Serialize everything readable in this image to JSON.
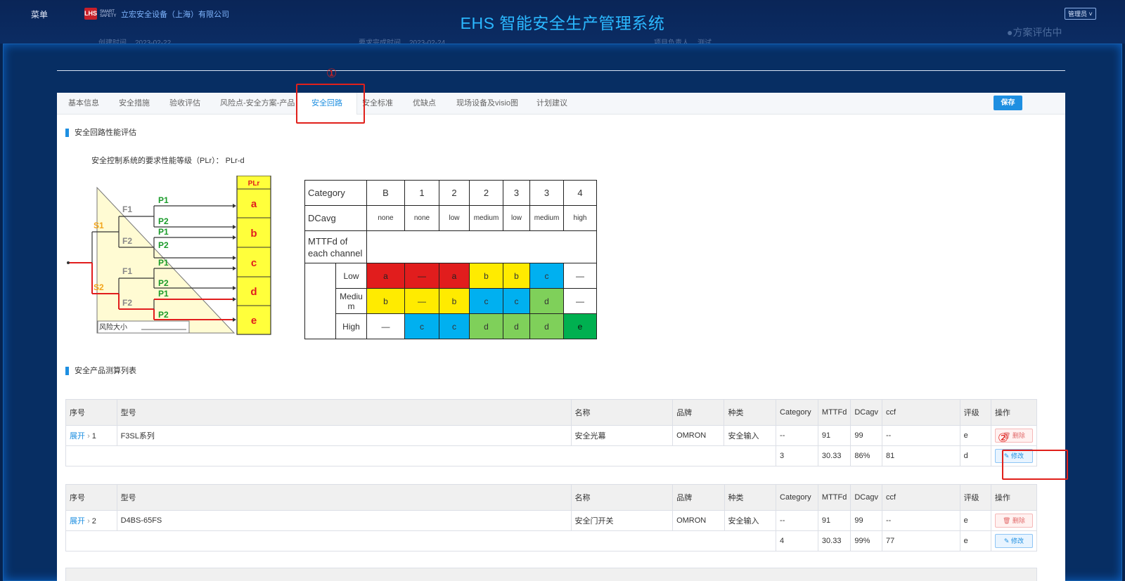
{
  "header": {
    "menu_label": "菜单",
    "logo_mark": "LHS",
    "logo_sub": "SMART SAFETY",
    "company": "立宏安全设备（上海）有限公司",
    "title": "EHS 智能安全生产管理系统",
    "user": "管理员",
    "status": "●方案评估中"
  },
  "meta": {
    "created_label": "创建时间",
    "created_value": "2023-02-22",
    "due_label": "要求完成时间",
    "due_value": "2023-02-24",
    "owner_label": "项目负责人",
    "owner_value": "测试"
  },
  "tabs": [
    "基本信息",
    "安全措施",
    "验收评估",
    "风险点-安全方案-产品",
    "安全回路",
    "安全标准",
    "优缺点",
    "现场设备及visio图",
    "计划建议"
  ],
  "active_tab": "安全回路",
  "save_label": "保存",
  "callouts": [
    "①",
    "②"
  ],
  "section1": {
    "title": "安全回路性能评估",
    "plr_text": "安全控制系统的要求性能等级（PLr）： PLr-d"
  },
  "risk_graph": {
    "plr_header": "PLr",
    "levels": [
      "a",
      "b",
      "c",
      "d",
      "e"
    ],
    "s_labels": [
      "S1",
      "S2"
    ],
    "f_labels": [
      "F1",
      "F2",
      "F1",
      "F2"
    ],
    "p_labels": [
      "P1",
      "P2",
      "P1",
      "P2",
      "P1",
      "P2",
      "P1",
      "P2"
    ],
    "footer": "风险大小"
  },
  "category_matrix": {
    "category_label": "Category",
    "categories": [
      "B",
      "1",
      "2",
      "2",
      "3",
      "3",
      "4"
    ],
    "dcavg_label": "DCavg",
    "dcavg": [
      "none",
      "none",
      "low",
      "medium",
      "low",
      "medium",
      "high"
    ],
    "mttfd_label": "MTTFd of each channel",
    "rows": [
      {
        "label": "Low",
        "cells": [
          "a",
          "—",
          "a",
          "b",
          "b",
          "c",
          "—"
        ],
        "colors": [
          "#e11d1d",
          "#e11d1d",
          "#e11d1d",
          "#ffeb00",
          "#ffeb00",
          "#00b0f0",
          "#ffffff"
        ]
      },
      {
        "label": "Mediu m",
        "cells": [
          "b",
          "—",
          "b",
          "c",
          "c",
          "d",
          "—"
        ],
        "colors": [
          "#ffeb00",
          "#ffeb00",
          "#ffeb00",
          "#00b0f0",
          "#00b0f0",
          "#7fd05a",
          "#ffffff"
        ]
      },
      {
        "label": "High",
        "cells": [
          "—",
          "c",
          "c",
          "d",
          "d",
          "d",
          "e"
        ],
        "colors": [
          "#ffffff",
          "#00b0f0",
          "#00b0f0",
          "#7fd05a",
          "#7fd05a",
          "#7fd05a",
          "#00b050"
        ]
      }
    ]
  },
  "section2": {
    "title": "安全产品测算列表"
  },
  "product_columns": [
    "序号",
    "型号",
    "名称",
    "品牌",
    "种类",
    "Category",
    "MTTFd",
    "DCagv",
    "ccf",
    "评级",
    "操作"
  ],
  "expand_label": "展开",
  "delete_label": "删除",
  "edit_label": "修改",
  "products": [
    {
      "no": "1",
      "model": "F3SL系列",
      "name": "安全光幕",
      "brand": "OMRON",
      "kind": "安全输入",
      "category": "--",
      "mttfd": "91",
      "dcagv": "99",
      "ccf": "--",
      "grade": "e",
      "calc": {
        "category": "3",
        "mttfd": "30.33",
        "dcagv": "86%",
        "ccf": "81",
        "grade": "d"
      }
    },
    {
      "no": "2",
      "model": "D4BS-65FS",
      "name": "安全门开关",
      "brand": "OMRON",
      "kind": "安全输入",
      "category": "--",
      "mttfd": "91",
      "dcagv": "99",
      "ccf": "--",
      "grade": "e",
      "calc": {
        "category": "4",
        "mttfd": "30.33",
        "dcagv": "99%",
        "ccf": "77",
        "grade": "e"
      }
    }
  ]
}
